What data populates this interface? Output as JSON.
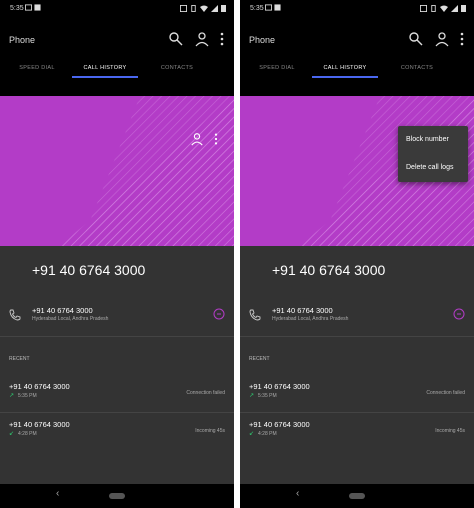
{
  "colors": {
    "accent": "#b33cc7",
    "tab_indicator": "#4a67f0",
    "dark_bg": "#333333",
    "incoming_arrow": "#2ecc71",
    "failed_arrow": "#2ecc71"
  },
  "status_bar": {
    "time": "5:35"
  },
  "app_bar": {
    "title": "Phone",
    "icons": [
      "search-icon",
      "add-contact-icon",
      "more-icon"
    ]
  },
  "tabs": {
    "speed_dial": "SPEED DIAL",
    "call_history": "CALL HISTORY",
    "contacts": "CONTACTS"
  },
  "contact": {
    "number_large": "+91 40 6764 3000",
    "number": "+91 40 6764 3000",
    "location": "Hyderabad Local, Andhra Pradesh"
  },
  "recent": {
    "header": "RECENT",
    "calls": [
      {
        "number": "+91 40 6764 3000",
        "time": "5:35 PM",
        "status": "Connection failed",
        "arrow": "↗"
      },
      {
        "number": "+91 40 6764 3000",
        "time": "4:28 PM",
        "status": "Incoming 45s",
        "arrow": "↙"
      }
    ]
  },
  "menu": {
    "block": "Block number",
    "delete": "Delete call logs"
  }
}
